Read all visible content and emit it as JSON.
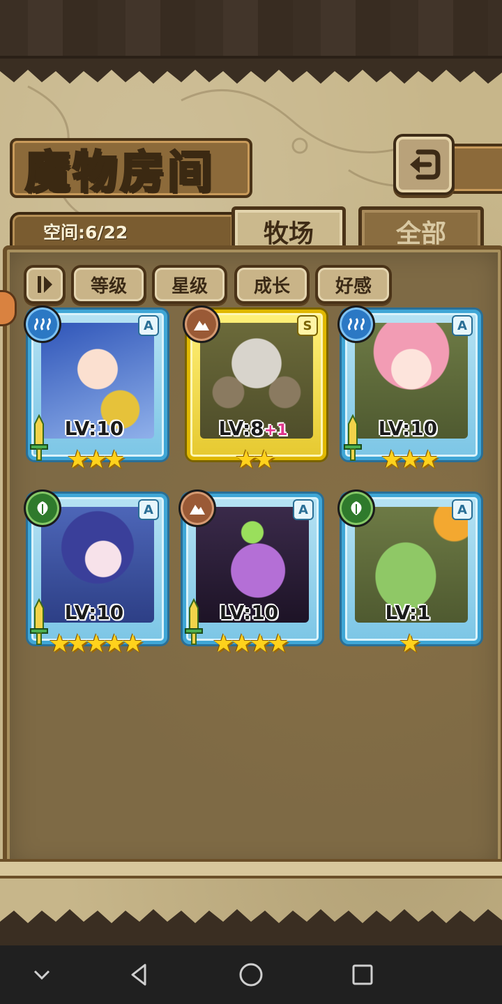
{
  "header": {
    "title": "魔物房间",
    "capacity_text": "空间:6/22"
  },
  "tabs": [
    {
      "label": "牧场",
      "active": true
    },
    {
      "label": "全部",
      "active": false
    }
  ],
  "filters": [
    "等级",
    "星级",
    "成长",
    "好感"
  ],
  "monsters": [
    {
      "element": "water",
      "rank": "A",
      "level": "LV:10",
      "bonus": "",
      "stars": 3,
      "stars_text": "★★★",
      "frame": "blue"
    },
    {
      "element": "earth",
      "rank": "S",
      "level": "LV:8",
      "bonus": "+1",
      "stars": 2,
      "stars_text": "★★",
      "frame": "gold"
    },
    {
      "element": "water",
      "rank": "A",
      "level": "LV:10",
      "bonus": "",
      "stars": 3,
      "stars_text": "★★★",
      "frame": "blue"
    },
    {
      "element": "wood",
      "rank": "A",
      "level": "LV:10",
      "bonus": "",
      "stars": 5,
      "stars_text": "★★★★★",
      "frame": "blue"
    },
    {
      "element": "earth",
      "rank": "A",
      "level": "LV:10",
      "bonus": "",
      "stars": 4,
      "stars_text": "★★★★",
      "frame": "blue"
    },
    {
      "element": "wood",
      "rank": "A",
      "level": "LV:1",
      "bonus": "",
      "stars": 1,
      "stars_text": "★",
      "frame": "blue"
    }
  ],
  "colors": {
    "parchment": "#c7b68a",
    "panel": "#7e6a45",
    "card_blue": "#3fa6d6",
    "card_gold": "#e0b800",
    "star": "#ffd21c"
  }
}
